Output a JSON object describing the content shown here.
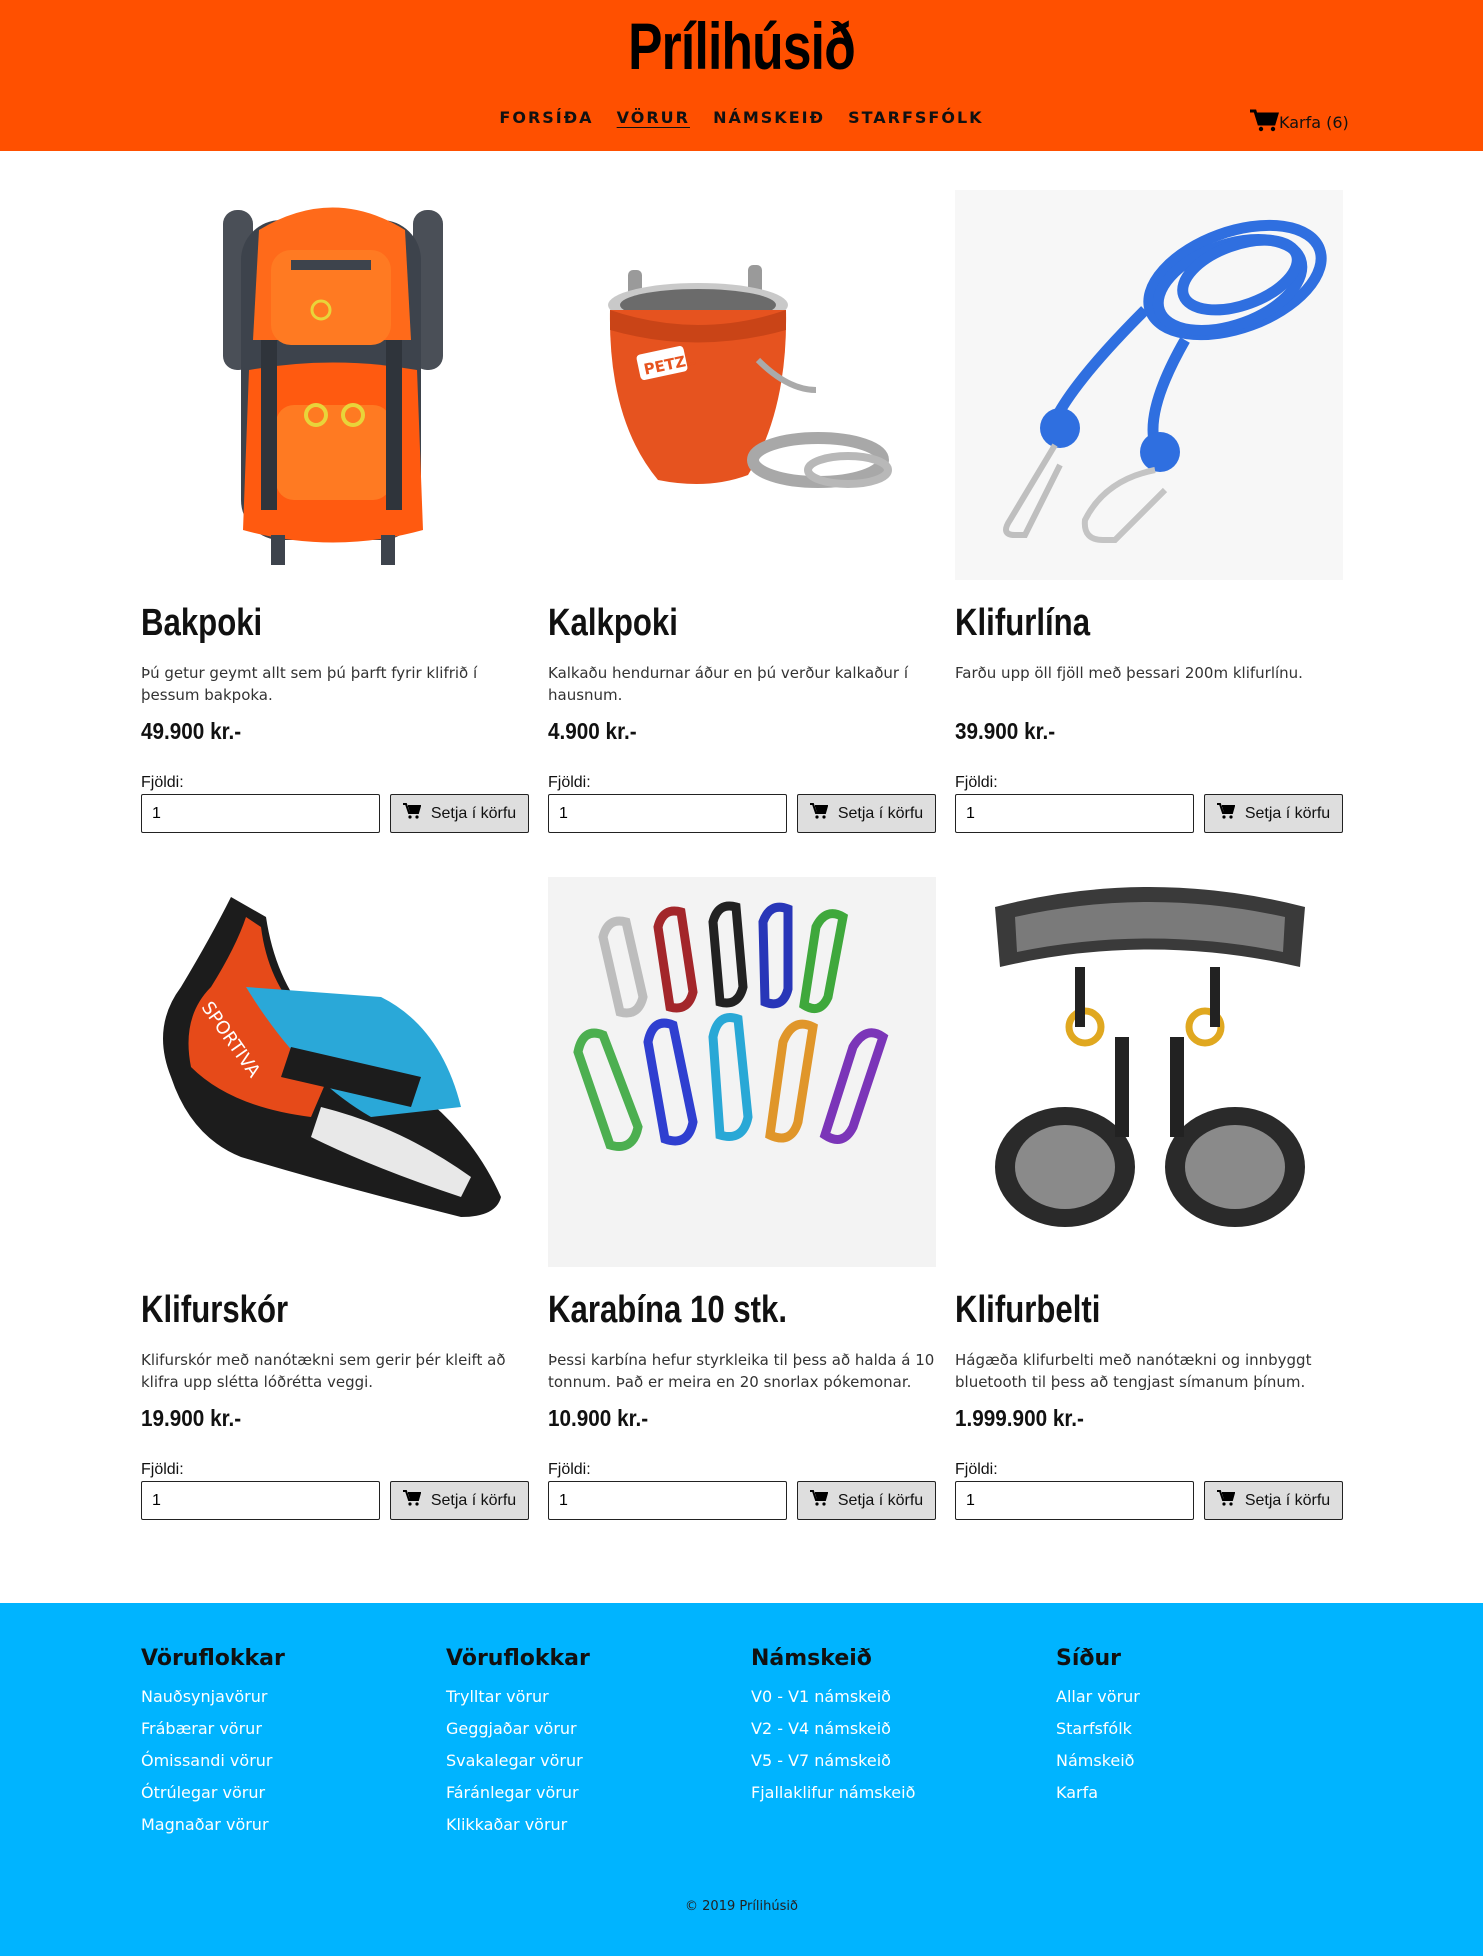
{
  "site": {
    "title": "Prílihúsið"
  },
  "nav": {
    "items": [
      {
        "label": "FORSÍÐA",
        "active": false
      },
      {
        "label": "VÖRUR",
        "active": true
      },
      {
        "label": "NÁMSKEIÐ",
        "active": false
      },
      {
        "label": "STARFSFÓLK",
        "active": false
      }
    ],
    "cart_label": "Karfa (6)"
  },
  "product_ui": {
    "qty_label": "Fjöldi:",
    "qty_default": "1",
    "add_label": "Setja í körfu"
  },
  "products": [
    {
      "name": "Bakpoki",
      "description": "Þú getur geymt allt sem þú þarft fyrir klifrið í þessum bakpoka.",
      "price": "49.900 kr.-",
      "image": "backpack"
    },
    {
      "name": "Kalkpoki",
      "description": "Kalkaðu hendurnar áður en þú verður kalkaður í hausnum.",
      "price": "4.900 kr.-",
      "image": "chalk-bag"
    },
    {
      "name": "Klifurlína",
      "description": "Farðu upp öll fjöll með þessari 200m klifurlínu.",
      "price": "39.900 kr.-",
      "image": "rope"
    },
    {
      "name": "Klifurskór",
      "description": "Klifurskór með nanótækni sem gerir þér kleift að klifra upp slétta lóðrétta veggi.",
      "price": "19.900 kr.-",
      "image": "climbing-shoe"
    },
    {
      "name": "Karabína 10 stk.",
      "description": "Þessi karbína hefur styrkleika til þess að halda á 10 tonnum. Það er meira en 20 snorlax pókemonar.",
      "price": "10.900 kr.-",
      "image": "carabiners"
    },
    {
      "name": "Klifurbelti",
      "description": "Hágæða klifurbelti með nanótækni og innbyggt bluetooth til þess að tengjast símanum þínum.",
      "price": "1.999.900 kr.-",
      "image": "harness"
    }
  ],
  "footer": {
    "columns": [
      {
        "title": "Vöruflokkar",
        "links": [
          "Nauðsynjavörur",
          "Frábærar vörur",
          "Ómissandi vörur",
          "Ótrúlegar vörur",
          "Magnaðar vörur"
        ]
      },
      {
        "title": "Vöruflokkar",
        "links": [
          "Trylltar vörur",
          "Geggjaðar vörur",
          "Svakalegar vörur",
          "Fáránlegar vörur",
          "Klikkaðar vörur"
        ]
      },
      {
        "title": "Námskeið",
        "links": [
          "V0 - V1 námskeið",
          "V2 - V4 námskeið",
          "V5 - V7 námskeið",
          "Fjallaklifur námskeið"
        ]
      },
      {
        "title": "Síður",
        "links": [
          "Allar vörur",
          "Starfsfólk",
          "Námskeið",
          "Karfa"
        ]
      }
    ],
    "copyright": "© 2019 Prílihúsið"
  },
  "colors": {
    "header": "#ff5000",
    "footer": "#00b4ff"
  }
}
